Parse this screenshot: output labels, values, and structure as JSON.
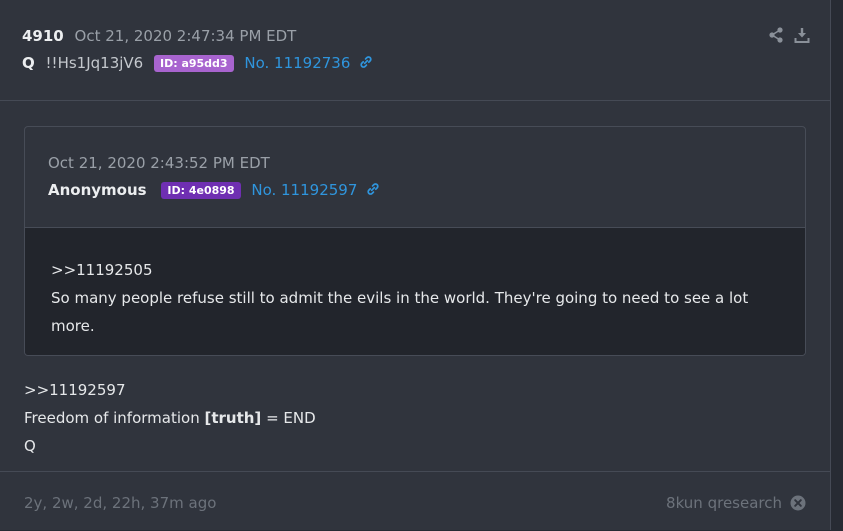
{
  "post": {
    "number": "4910",
    "timestamp": "Oct 21, 2020 2:47:34 PM EDT",
    "author": "Q",
    "tripcode": "!!Hs1Jq13jV6",
    "id_badge": "ID: a95dd3",
    "post_link": "No. 11192736",
    "badge_color": "#a864cf",
    "link_color": "#2f95dd"
  },
  "quoted": {
    "timestamp": "Oct 21, 2020 2:43:52 PM EDT",
    "author": "Anonymous",
    "id_badge": "ID: 4e0898",
    "post_link": "No. 11192597",
    "badge_color": "#6f2fb2",
    "line1": ">>11192505",
    "line2": "So many people refuse still to admit the evils in the world. They're going to need to see a lot more."
  },
  "body": {
    "line1": ">>11192597",
    "line2_pre": "Freedom of information ",
    "line2_bold": "[truth]",
    "line2_post": " = END",
    "line3": "Q"
  },
  "footer": {
    "age": "2y, 2w, 2d, 22h, 37m ago",
    "source": "8kun qresearch"
  },
  "icons": {
    "share": "share-icon",
    "download": "download-icon",
    "link": "link-icon",
    "close": "close-circle-icon"
  }
}
